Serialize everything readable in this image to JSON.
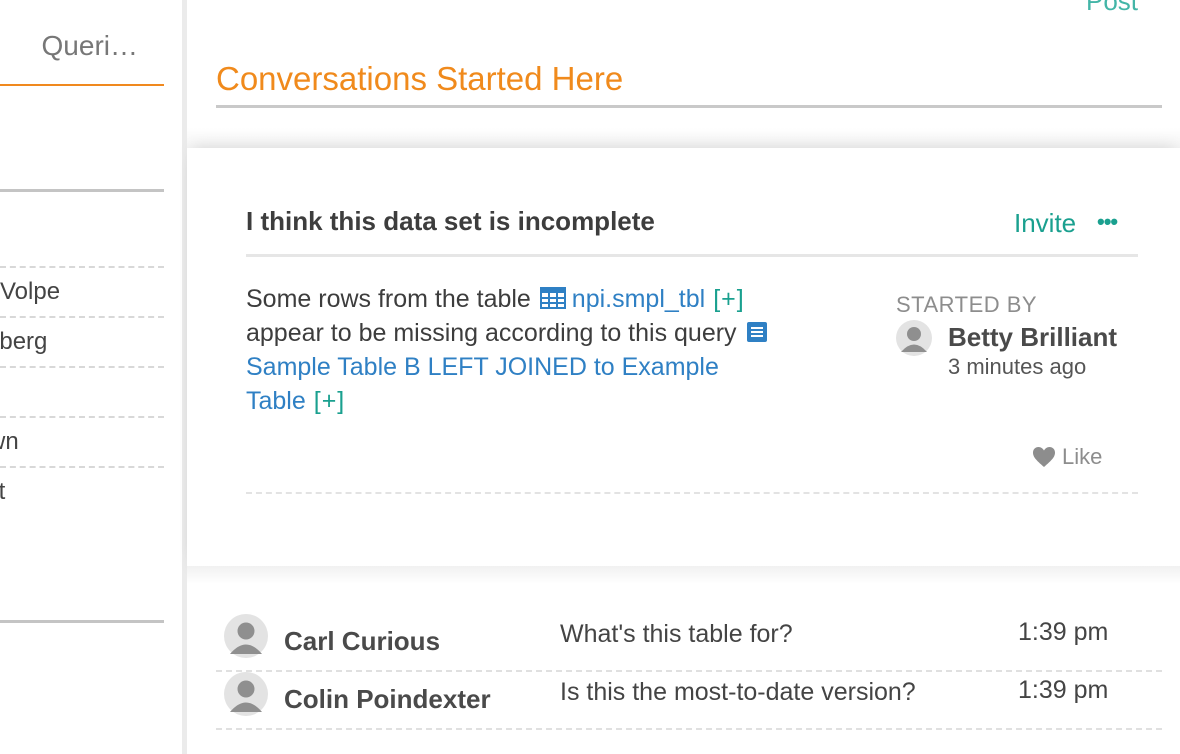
{
  "left_panel": {
    "tab_label": "Queri…",
    "names": [
      "Volpe",
      "nberg",
      "wn",
      "tt"
    ]
  },
  "header": {
    "post_label": "Post",
    "section_title": "Conversations Started Here"
  },
  "conversation": {
    "title": "I think this data set is incomplete",
    "invite_label": "Invite",
    "more_label": "•••",
    "body_text_1": "Some rows from the table",
    "table_link": "npi.smpl_tbl",
    "plus_1": "[+]",
    "body_text_2": "appear to be missing according to this query",
    "query_link_line1": "Sample Table B LEFT JOINED to Example",
    "query_link_line2": "Table",
    "plus_2": "[+]",
    "started_by_label": "STARTED BY",
    "starter_name": "Betty Brilliant",
    "started_time": "3 minutes ago",
    "like_label": "Like"
  },
  "replies": [
    {
      "name": "Carl Curious",
      "text": "What's this table for?",
      "time": "1:39 pm"
    },
    {
      "name": "Colin Poindexter",
      "text": "Is this the most-to-date version?",
      "time": "1:39 pm"
    }
  ],
  "colors": {
    "accent_orange": "#f08a1c",
    "accent_teal": "#1aa08f",
    "link_blue": "#2f80c4"
  },
  "icons": [
    "table-icon",
    "query-icon",
    "avatar-icon",
    "heart-icon",
    "more-icon"
  ]
}
